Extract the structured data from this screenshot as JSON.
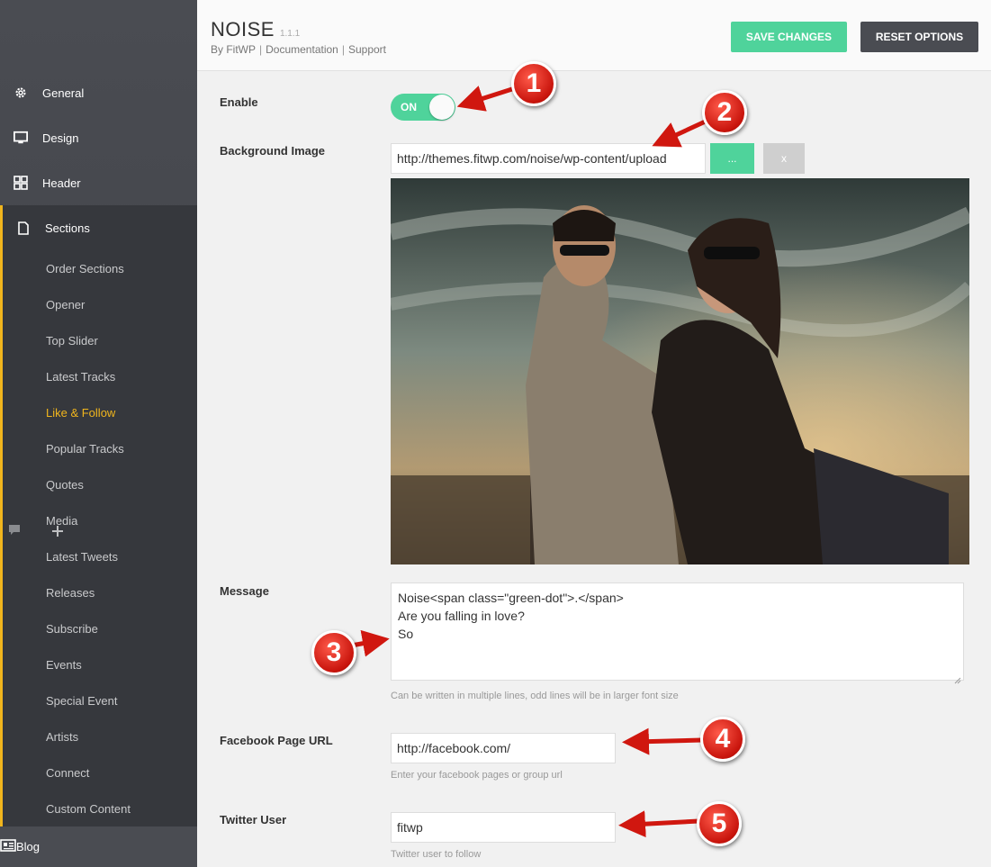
{
  "sidebar": {
    "top_items": [
      {
        "label": "General",
        "icon": "gear-icon"
      },
      {
        "label": "Design",
        "icon": "monitor-icon"
      },
      {
        "label": "Header",
        "icon": "grid-icon"
      }
    ],
    "sections_label": "Sections",
    "sub_items": [
      {
        "label": "Order Sections"
      },
      {
        "label": "Opener"
      },
      {
        "label": "Top Slider"
      },
      {
        "label": "Latest Tracks"
      },
      {
        "label": "Like & Follow",
        "active": true
      },
      {
        "label": "Popular Tracks"
      },
      {
        "label": "Quotes"
      },
      {
        "label": "Media"
      },
      {
        "label": "Latest Tweets"
      },
      {
        "label": "Releases"
      },
      {
        "label": "Subscribe"
      },
      {
        "label": "Events"
      },
      {
        "label": "Special Event"
      },
      {
        "label": "Artists"
      },
      {
        "label": "Connect"
      },
      {
        "label": "Custom Content"
      }
    ],
    "blog_label": "Blog",
    "accent_color": "#f0b51d"
  },
  "header": {
    "title": "NOISE",
    "version": "1.1.1",
    "byline_by": "By FitWP",
    "byline_docs": "Documentation",
    "byline_support": "Support",
    "save_label": "SAVE CHANGES",
    "reset_label": "RESET OPTIONS",
    "save_color": "#4fd39b"
  },
  "form": {
    "enable_label": "Enable",
    "enable_state": "ON",
    "bg_label": "Background Image",
    "bg_value": "http://themes.fitwp.com/noise/wp-content/upload",
    "bg_browse": "...",
    "bg_remove": "x",
    "message_label": "Message",
    "message_lines": [
      "Noise<span class=\"green-dot\">.</span>",
      "Are you falling in love?",
      "So"
    ],
    "message_help": "Can be written in multiple lines, odd lines will be in larger font size",
    "facebook_label": "Facebook Page URL",
    "facebook_value": "http://facebook.com/",
    "facebook_help": "Enter your facebook pages or group url",
    "twitter_label": "Twitter User",
    "twitter_value": "fitwp",
    "twitter_help": "Twitter user to follow"
  },
  "callouts": [
    "1",
    "2",
    "3",
    "4",
    "5"
  ]
}
